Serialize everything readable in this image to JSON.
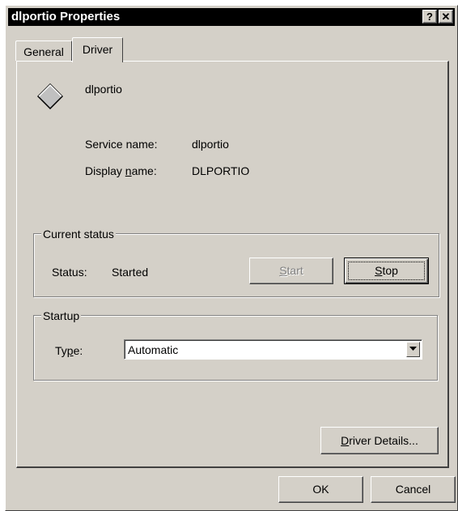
{
  "window": {
    "title": "dlportio Properties",
    "help_glyph": "?",
    "close_glyph": "✕"
  },
  "tabs": [
    {
      "label": "General"
    },
    {
      "label": "Driver"
    }
  ],
  "driver": {
    "icon": "driver-diamond-icon",
    "name": "dlportio",
    "service_name_label": "Service name:",
    "service_name_value": "dlportio",
    "display_name_label_pre": "Display ",
    "display_name_label_accel": "n",
    "display_name_label_post": "ame:",
    "display_name_value": "DLPORTIO"
  },
  "current_status": {
    "title": "Current status",
    "status_label": "Status:",
    "status_value": "Started",
    "start_accel": "S",
    "start_rest": "tart",
    "stop_accel": "S",
    "stop_rest": "top"
  },
  "startup": {
    "title": "Startup",
    "type_label_pre": "Ty",
    "type_label_accel": "p",
    "type_label_post": "e:",
    "type_value": "Automatic"
  },
  "buttons": {
    "driver_details_accel": "D",
    "driver_details_rest": "river Details...",
    "ok": "OK",
    "cancel": "Cancel"
  },
  "colors": {
    "face": "#d4d0c8",
    "titlebar": "#000000"
  }
}
